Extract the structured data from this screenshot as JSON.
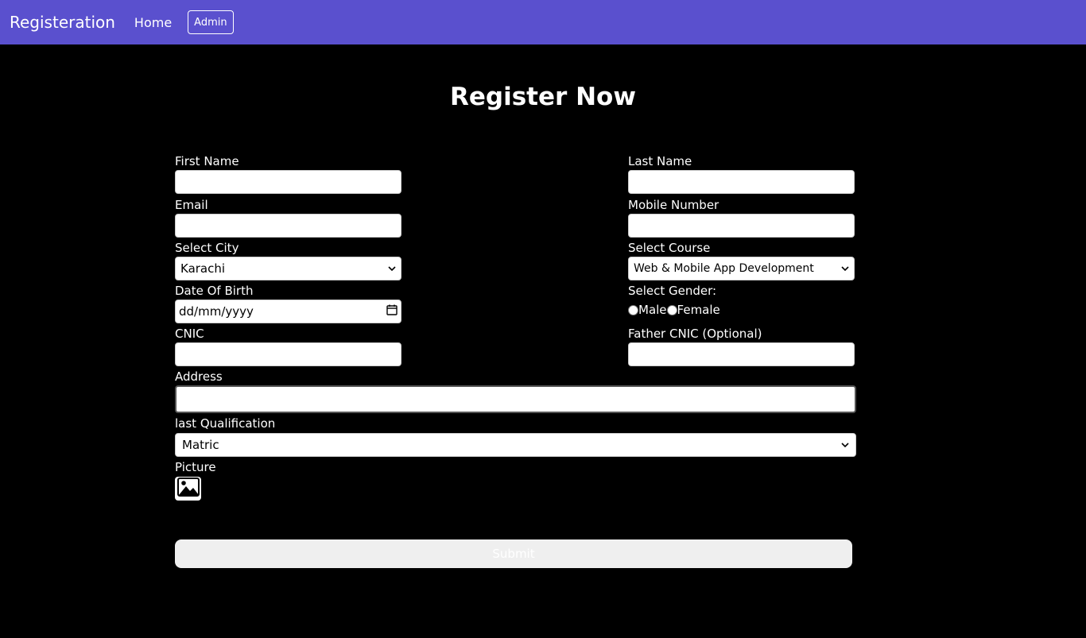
{
  "nav": {
    "brand": "Registeration",
    "home": "Home",
    "admin": "Admin"
  },
  "title": "Register Now",
  "form": {
    "first_name": {
      "label": "First Name",
      "value": ""
    },
    "last_name": {
      "label": "Last Name",
      "value": ""
    },
    "email": {
      "label": "Email",
      "value": ""
    },
    "mobile": {
      "label": "Mobile Number",
      "value": ""
    },
    "city": {
      "label": "Select City",
      "value": "Karachi"
    },
    "course": {
      "label": "Select Course",
      "value": "Web & Mobile App Development"
    },
    "dob": {
      "label": "Date Of Birth",
      "placeholder": "dd/mm/yyyy"
    },
    "gender": {
      "label": "Select Gender:",
      "options": [
        "Male",
        "Female"
      ]
    },
    "cnic": {
      "label": "CNIC",
      "value": ""
    },
    "father_cnic": {
      "label": "Father CNIC (Optional)",
      "value": ""
    },
    "address": {
      "label": "Address",
      "value": ""
    },
    "qualification": {
      "label": "last Qualification",
      "value": "Matric"
    },
    "picture": {
      "label": "Picture",
      "icon": "image-icon"
    },
    "submit_label": "Submit"
  },
  "colors": {
    "navbar": "#5a50ce",
    "background": "#000000",
    "submit_bg": "#efefef"
  }
}
